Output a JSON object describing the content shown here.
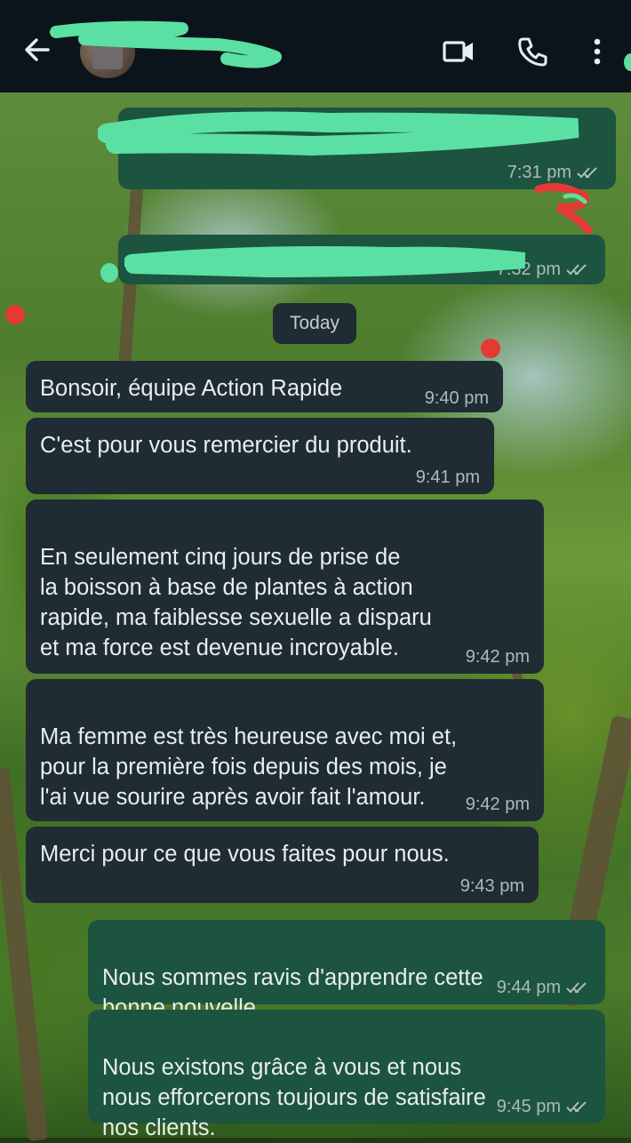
{
  "header": {
    "back_icon": "arrow-left-icon",
    "contact_name": "",
    "video_icon": "video-camera-icon",
    "call_icon": "phone-icon",
    "menu_icon": "more-vertical-icon"
  },
  "colors": {
    "header_bg": "#0b141a",
    "incoming_bubble": "#1f2c34",
    "outgoing_bubble": "#1c5440",
    "scribble_green": "#5be0a3",
    "scribble_red": "#e53935"
  },
  "day_separator": "Today",
  "messages": [
    {
      "direction": "out",
      "text": "",
      "time": "7:31 pm",
      "status": "read",
      "redacted": true
    },
    {
      "direction": "out",
      "text": "",
      "time": "7:32 pm",
      "status": "read",
      "redacted": true
    },
    {
      "direction": "in",
      "text": "Bonsoir, équipe Action Rapide",
      "time": "9:40 pm"
    },
    {
      "direction": "in",
      "text": "C'est pour vous remercier du produit.",
      "time": "9:41 pm"
    },
    {
      "direction": "in",
      "text": "En seulement cinq jours de prise de\nla boisson à base de plantes à action\nrapide, ma faiblesse sexuelle a disparu\net ma force est devenue incroyable.",
      "time": "9:42 pm"
    },
    {
      "direction": "in",
      "text": "Ma femme est très heureuse avec moi et,\npour la première fois depuis des mois, je\nl'ai vue sourire après avoir fait l'amour.",
      "time": "9:42 pm"
    },
    {
      "direction": "in",
      "text": "Merci pour ce que vous faites pour nous.",
      "time": "9:43 pm"
    },
    {
      "direction": "out",
      "text": "Nous sommes ravis d'apprendre cette\nbonne nouvelle.",
      "time": "9:44 pm",
      "status": "read"
    },
    {
      "direction": "out",
      "text": "Nous existons grâce à vous et nous\nnous efforcerons toujours de satisfaire\nnos clients.",
      "time": "9:45 pm",
      "status": "read"
    }
  ]
}
